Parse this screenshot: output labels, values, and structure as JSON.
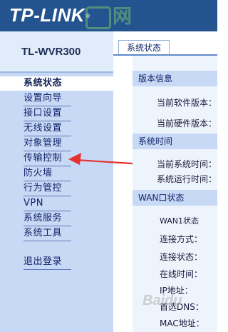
{
  "header": {
    "logo": "TP-LINK",
    "logo_mark": "®",
    "watermark": "网"
  },
  "sidebar": {
    "model": "TL-WVR300",
    "items": [
      {
        "label": "系统状态",
        "active": true
      },
      {
        "label": "设置向导"
      },
      {
        "label": "接口设置"
      },
      {
        "label": "无线设置"
      },
      {
        "label": "对象管理"
      },
      {
        "label": "传输控制"
      },
      {
        "label": "防火墙"
      },
      {
        "label": "行为管控"
      },
      {
        "label": "VPN"
      },
      {
        "label": "系统服务"
      },
      {
        "label": "系统工具"
      },
      {
        "label": "退出登录"
      }
    ]
  },
  "tab": {
    "label": "系统状态"
  },
  "sections": {
    "version": {
      "title": "版本信息",
      "rows": [
        "当前软件版本：",
        "当前硬件版本："
      ]
    },
    "time": {
      "title": "系统时间",
      "rows": [
        "当前系统时间：",
        "系统运行时间："
      ]
    },
    "wan": {
      "title": "WAN口状态",
      "rows": [
        "WAN1状态",
        "连接方式：",
        "连接状态：",
        "在线时间：",
        "IP地址：",
        "首选DNS：",
        "MAC地址："
      ]
    }
  },
  "watermark_bottom": "Baidu",
  "colors": {
    "header_bg": "#23548f",
    "sidebar_bg": "#c7d9f4",
    "arrow": "#e4332f"
  }
}
